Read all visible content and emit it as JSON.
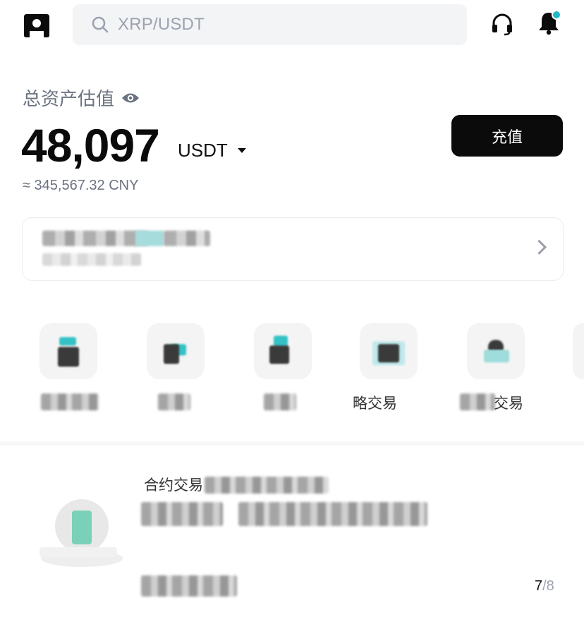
{
  "header": {
    "logo_icon": "exchange-logo-icon",
    "search_placeholder": "XRP/USDT",
    "support_icon": "headset-icon",
    "notification_icon": "bell-icon",
    "notification_dot_color": "#22b8c7"
  },
  "assets": {
    "label": "总资产估值",
    "visibility_icon": "eye-icon",
    "balance": "48,097",
    "unit": "USDT",
    "cny_value": "≈ 345,567.32 CNY",
    "deposit_label": "充值"
  },
  "quick_actions": [
    {
      "icon": "gift-icon",
      "label": ""
    },
    {
      "icon": "grid-icon",
      "label": ""
    },
    {
      "icon": "copy-icon",
      "label": ""
    },
    {
      "icon": "strategy-icon",
      "label": "略交易"
    },
    {
      "icon": "trade-icon",
      "label": "交易"
    }
  ],
  "promo": {
    "title_prefix": "合约交易",
    "page_current": "7",
    "page_total": "/8"
  },
  "colors": {
    "accent": "#22b8c7",
    "primary_button": "#0b0b0b"
  }
}
